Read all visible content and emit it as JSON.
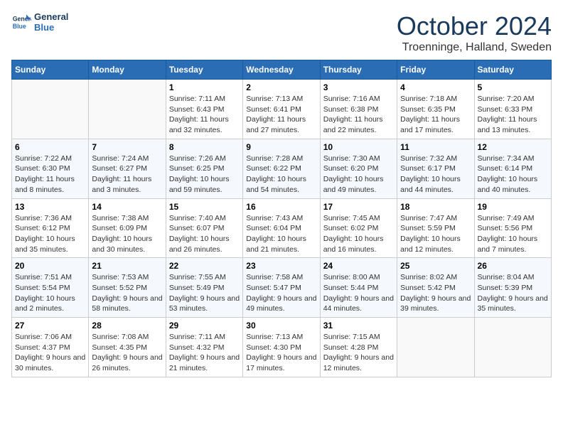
{
  "logo": {
    "line1": "General",
    "line2": "Blue"
  },
  "header": {
    "month": "October 2024",
    "location": "Troenninge, Halland, Sweden"
  },
  "days_of_week": [
    "Sunday",
    "Monday",
    "Tuesday",
    "Wednesday",
    "Thursday",
    "Friday",
    "Saturday"
  ],
  "weeks": [
    [
      {
        "day": "",
        "info": ""
      },
      {
        "day": "",
        "info": ""
      },
      {
        "day": "1",
        "info": "Sunrise: 7:11 AM\nSunset: 6:43 PM\nDaylight: 11 hours and 32 minutes."
      },
      {
        "day": "2",
        "info": "Sunrise: 7:13 AM\nSunset: 6:41 PM\nDaylight: 11 hours and 27 minutes."
      },
      {
        "day": "3",
        "info": "Sunrise: 7:16 AM\nSunset: 6:38 PM\nDaylight: 11 hours and 22 minutes."
      },
      {
        "day": "4",
        "info": "Sunrise: 7:18 AM\nSunset: 6:35 PM\nDaylight: 11 hours and 17 minutes."
      },
      {
        "day": "5",
        "info": "Sunrise: 7:20 AM\nSunset: 6:33 PM\nDaylight: 11 hours and 13 minutes."
      }
    ],
    [
      {
        "day": "6",
        "info": "Sunrise: 7:22 AM\nSunset: 6:30 PM\nDaylight: 11 hours and 8 minutes."
      },
      {
        "day": "7",
        "info": "Sunrise: 7:24 AM\nSunset: 6:27 PM\nDaylight: 11 hours and 3 minutes."
      },
      {
        "day": "8",
        "info": "Sunrise: 7:26 AM\nSunset: 6:25 PM\nDaylight: 10 hours and 59 minutes."
      },
      {
        "day": "9",
        "info": "Sunrise: 7:28 AM\nSunset: 6:22 PM\nDaylight: 10 hours and 54 minutes."
      },
      {
        "day": "10",
        "info": "Sunrise: 7:30 AM\nSunset: 6:20 PM\nDaylight: 10 hours and 49 minutes."
      },
      {
        "day": "11",
        "info": "Sunrise: 7:32 AM\nSunset: 6:17 PM\nDaylight: 10 hours and 44 minutes."
      },
      {
        "day": "12",
        "info": "Sunrise: 7:34 AM\nSunset: 6:14 PM\nDaylight: 10 hours and 40 minutes."
      }
    ],
    [
      {
        "day": "13",
        "info": "Sunrise: 7:36 AM\nSunset: 6:12 PM\nDaylight: 10 hours and 35 minutes."
      },
      {
        "day": "14",
        "info": "Sunrise: 7:38 AM\nSunset: 6:09 PM\nDaylight: 10 hours and 30 minutes."
      },
      {
        "day": "15",
        "info": "Sunrise: 7:40 AM\nSunset: 6:07 PM\nDaylight: 10 hours and 26 minutes."
      },
      {
        "day": "16",
        "info": "Sunrise: 7:43 AM\nSunset: 6:04 PM\nDaylight: 10 hours and 21 minutes."
      },
      {
        "day": "17",
        "info": "Sunrise: 7:45 AM\nSunset: 6:02 PM\nDaylight: 10 hours and 16 minutes."
      },
      {
        "day": "18",
        "info": "Sunrise: 7:47 AM\nSunset: 5:59 PM\nDaylight: 10 hours and 12 minutes."
      },
      {
        "day": "19",
        "info": "Sunrise: 7:49 AM\nSunset: 5:56 PM\nDaylight: 10 hours and 7 minutes."
      }
    ],
    [
      {
        "day": "20",
        "info": "Sunrise: 7:51 AM\nSunset: 5:54 PM\nDaylight: 10 hours and 2 minutes."
      },
      {
        "day": "21",
        "info": "Sunrise: 7:53 AM\nSunset: 5:52 PM\nDaylight: 9 hours and 58 minutes."
      },
      {
        "day": "22",
        "info": "Sunrise: 7:55 AM\nSunset: 5:49 PM\nDaylight: 9 hours and 53 minutes."
      },
      {
        "day": "23",
        "info": "Sunrise: 7:58 AM\nSunset: 5:47 PM\nDaylight: 9 hours and 49 minutes."
      },
      {
        "day": "24",
        "info": "Sunrise: 8:00 AM\nSunset: 5:44 PM\nDaylight: 9 hours and 44 minutes."
      },
      {
        "day": "25",
        "info": "Sunrise: 8:02 AM\nSunset: 5:42 PM\nDaylight: 9 hours and 39 minutes."
      },
      {
        "day": "26",
        "info": "Sunrise: 8:04 AM\nSunset: 5:39 PM\nDaylight: 9 hours and 35 minutes."
      }
    ],
    [
      {
        "day": "27",
        "info": "Sunrise: 7:06 AM\nSunset: 4:37 PM\nDaylight: 9 hours and 30 minutes."
      },
      {
        "day": "28",
        "info": "Sunrise: 7:08 AM\nSunset: 4:35 PM\nDaylight: 9 hours and 26 minutes."
      },
      {
        "day": "29",
        "info": "Sunrise: 7:11 AM\nSunset: 4:32 PM\nDaylight: 9 hours and 21 minutes."
      },
      {
        "day": "30",
        "info": "Sunrise: 7:13 AM\nSunset: 4:30 PM\nDaylight: 9 hours and 17 minutes."
      },
      {
        "day": "31",
        "info": "Sunrise: 7:15 AM\nSunset: 4:28 PM\nDaylight: 9 hours and 12 minutes."
      },
      {
        "day": "",
        "info": ""
      },
      {
        "day": "",
        "info": ""
      }
    ]
  ]
}
